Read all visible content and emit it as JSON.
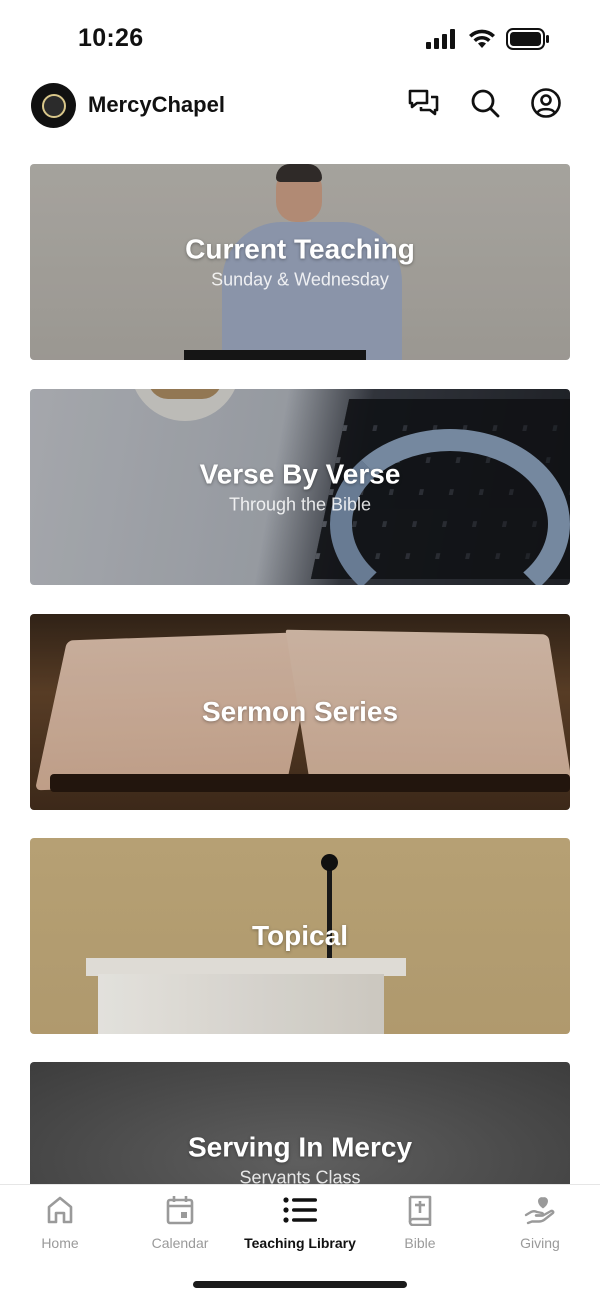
{
  "status_bar": {
    "time": "10:26",
    "icons": [
      "signal-icon",
      "wifi-icon",
      "battery-icon"
    ]
  },
  "header": {
    "app_name": "MercyChapel",
    "logo_icon": "church-logo-icon",
    "actions": [
      {
        "name": "chat-button",
        "icon": "chat-bubbles-icon"
      },
      {
        "name": "search-button",
        "icon": "search-icon"
      },
      {
        "name": "profile-button",
        "icon": "user-circle-icon"
      }
    ]
  },
  "cards": [
    {
      "title": "Current Teaching",
      "subtitle": "Sunday & Wednesday",
      "image": "pastor-speaking"
    },
    {
      "title": "Verse By Verse",
      "subtitle": "Through the Bible",
      "image": "laptop-headphones"
    },
    {
      "title": "Sermon Series",
      "subtitle": "",
      "image": "open-bible"
    },
    {
      "title": "Topical",
      "subtitle": "",
      "image": "podium-microphone"
    },
    {
      "title": "Serving In Mercy",
      "subtitle": "Servants Class",
      "image": "chalkboard"
    }
  ],
  "tab_bar": {
    "tabs": [
      {
        "label": "Home",
        "icon": "home-icon",
        "active": false
      },
      {
        "label": "Calendar",
        "icon": "calendar-icon",
        "active": false
      },
      {
        "label": "Teaching Library",
        "icon": "list-icon",
        "active": true
      },
      {
        "label": "Bible",
        "icon": "bible-icon",
        "active": false
      },
      {
        "label": "Giving",
        "icon": "giving-hand-icon",
        "active": false
      }
    ]
  },
  "colors": {
    "text_primary": "#111111",
    "tab_inactive": "#9a9a9a",
    "card_text": "#ffffff"
  }
}
